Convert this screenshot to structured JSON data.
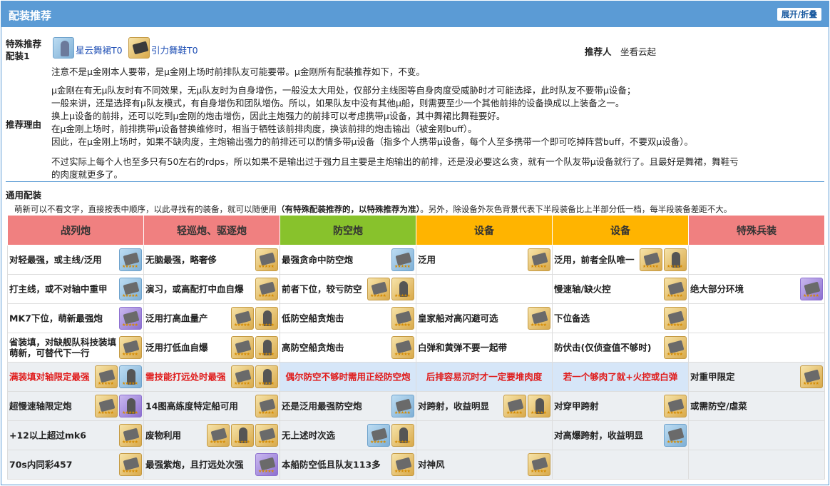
{
  "header": {
    "title": "配装推荐",
    "toggle": "展开/折叠"
  },
  "special": {
    "label1": "特殊推荐",
    "label2": "配装1",
    "item1": "星云舞裙T0",
    "item2": "引力舞鞋T0",
    "recommender_label": "推荐人",
    "recommender": "坐看云起",
    "note": "注意不是μ金刚本人要带，是μ金刚上场时前排队友可能要带。μ金刚所有配装推荐如下，不变。",
    "reason_label": "推荐理由",
    "reason_lines": [
      "μ金刚在有无μ队友时有不同效果，无μ队友时为自身增伤，一般没太大用处，仅部分主线图等自身肉度受威胁时才可能选择，此时队友不要带μ设备；",
      "一般来讲，还是选择有μ队友模式，有自身增伤和团队增伤。所以，如果队友中没有其他μ船，则需要至少一个其他前排的设备换成以上装备之一。",
      "换上μ设备的前排，还可以吃到μ金刚的炮击增伤，因此主炮强力的前排可以考虑携带μ设备，其中舞裙比舞鞋要好。",
      "在μ金刚上场时，前排携带μ设备替换维修时，相当于牺牲该前排肉度，换该前排的炮击输出（被金刚buff）。",
      "因此，在μ金刚上场时，如果不缺肉度，主炮输出强力的前排还可以酌情多带μ设备（指多个人携带μ设备，每个人至多携带一个即可吃掉阵营buff，不要双μ设备）。"
    ],
    "reason_last1": "不过实际上每个人也至多只有50左右的rdps，所以如果不是输出过于强力且主要是主炮输出的前排，还是没必要这么贪，就有一个队友带μ设备就行了。且最好是舞裙，舞鞋亏",
    "reason_last2": "的肉度就更多了。"
  },
  "general": {
    "label": "通用配装",
    "desc_a": "萌新可以不看文字，直接按表中顺序，以此寻找有的装备，就可以随便用",
    "desc_b": "（有特殊配装推荐的，以特殊推荐为准）",
    "desc_c": "。另外，除设备外灰色背景代表下半段装备比上半部分低一档，每半段装备差距不大。"
  },
  "table": {
    "headers": [
      {
        "label": "战列炮",
        "color": "#f08080"
      },
      {
        "label": "轻巡炮、驱逐炮",
        "color": "#f08080"
      },
      {
        "label": "防空炮",
        "color": "#88c22c"
      },
      {
        "label": "设备",
        "color": "#ffb400"
      },
      {
        "label": "设备",
        "color": "#ffb400"
      },
      {
        "label": "特殊兵装",
        "color": "#f08080"
      }
    ],
    "rows": [
      [
        "对轻最强，或主线/泛用",
        "无脑最强，略奢侈",
        "最强贪命中防空炮",
        "泛用",
        "泛用，前者全队唯一",
        ""
      ],
      [
        "打主线，或不对轴中重甲",
        "演习，或高配打中血自爆",
        "前者下位，较亏防空",
        "",
        "慢速轴/缺火控",
        "绝大部分环境"
      ],
      [
        "MK7下位，萌新最强炮",
        "泛用打高血量产",
        "低防空船贪炮击",
        "皇家船对高闪避可选",
        "下位备选",
        ""
      ],
      [
        "省装填，对缺舰队科技装填萌新，可替代下一行",
        "泛用打低血自爆",
        "高防空船贪炮击",
        "白弹和黄弹不要一起带",
        "防伏击(仅侦查值不够时)",
        ""
      ],
      [
        "满装填对轴限定最强",
        "需技能打远处时最强",
        "偶尔防空不够时需用正经防空炮",
        "后排容易沉时才一定要堆肉度",
        "若一个够肉了就+火控或白弹",
        "对重甲限定"
      ],
      [
        "超慢速轴限定炮",
        "14图高练度特定船可用",
        "还是泛用最强防空炮",
        "对跨射，收益明显",
        "对穿甲跨射",
        "或需防空/虐菜"
      ],
      [
        "+12以上超过mk6",
        "废物利用",
        "无上述时次选",
        "",
        "对高爆跨射，收益明显",
        ""
      ],
      [
        "70s内同彩457",
        "最强紫炮，且打远处次强",
        "本船防空低且队友113多",
        "对神风",
        "",
        ""
      ]
    ]
  }
}
